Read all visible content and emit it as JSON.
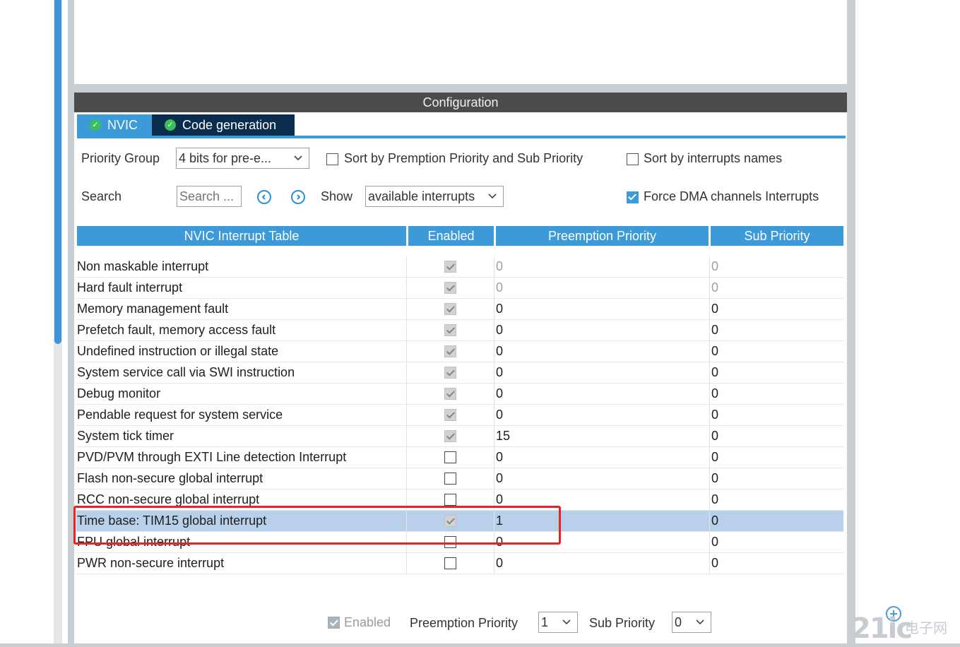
{
  "panel": {
    "title": "Configuration",
    "tabs": [
      {
        "label": "NVIC",
        "active": true
      },
      {
        "label": "Code generation",
        "active": false
      }
    ]
  },
  "toolbar": {
    "priority_group_label": "Priority Group",
    "priority_group_value": "4 bits for pre-e...",
    "sort_premption_label": "Sort by Premption Priority and Sub Priority",
    "sort_premption_checked": false,
    "sort_names_label": "Sort by interrupts names",
    "sort_names_checked": false,
    "search_label": "Search",
    "search_placeholder": "Search ...",
    "show_label": "Show",
    "show_value": "available interrupts",
    "force_dma_label": "Force DMA channels Interrupts",
    "force_dma_checked": true
  },
  "table": {
    "headers": [
      "NVIC Interrupt Table",
      "Enabled",
      "Preemption Priority",
      "Sub Priority"
    ],
    "rows": [
      {
        "name": "Non maskable interrupt",
        "enabled": true,
        "locked": true,
        "preemption": "0",
        "sub": "0",
        "grey_values": true
      },
      {
        "name": "Hard fault interrupt",
        "enabled": true,
        "locked": true,
        "preemption": "0",
        "sub": "0",
        "grey_values": true
      },
      {
        "name": "Memory management fault",
        "enabled": true,
        "locked": true,
        "preemption": "0",
        "sub": "0"
      },
      {
        "name": "Prefetch fault, memory access fault",
        "enabled": true,
        "locked": true,
        "preemption": "0",
        "sub": "0"
      },
      {
        "name": "Undefined instruction or illegal state",
        "enabled": true,
        "locked": true,
        "preemption": "0",
        "sub": "0"
      },
      {
        "name": "System service call via SWI instruction",
        "enabled": true,
        "locked": true,
        "preemption": "0",
        "sub": "0"
      },
      {
        "name": "Debug monitor",
        "enabled": true,
        "locked": true,
        "preemption": "0",
        "sub": "0"
      },
      {
        "name": "Pendable request for system service",
        "enabled": true,
        "locked": true,
        "preemption": "0",
        "sub": "0"
      },
      {
        "name": "System tick timer",
        "enabled": true,
        "locked": true,
        "preemption": "15",
        "sub": "0"
      },
      {
        "name": "PVD/PVM through EXTI Line detection Interrupt",
        "enabled": false,
        "preemption": "0",
        "sub": "0"
      },
      {
        "name": "Flash non-secure global interrupt",
        "enabled": false,
        "preemption": "0",
        "sub": "0"
      },
      {
        "name": "RCC non-secure global interrupt",
        "enabled": false,
        "preemption": "0",
        "sub": "0"
      },
      {
        "name": "Time base: TIM15 global interrupt",
        "enabled": true,
        "locked": true,
        "preemption": "1",
        "sub": "0",
        "selected": true
      },
      {
        "name": "FPU global interrupt",
        "enabled": false,
        "preemption": "0",
        "sub": "0"
      },
      {
        "name": "PWR non-secure interrupt",
        "enabled": false,
        "preemption": "0",
        "sub": "0"
      }
    ]
  },
  "bottom": {
    "enabled_label": "Enabled",
    "enabled_checked": true,
    "preemption_label": "Preemption Priority",
    "preemption_value": "1",
    "sub_label": "Sub Priority",
    "sub_value": "0"
  },
  "watermark": {
    "text": "21ic",
    "subtext": "电子网"
  },
  "colors": {
    "accent": "#3c9ad8",
    "header_dark": "#4b4b4b",
    "tab_dark": "#0b2d4d",
    "selected_row": "#b8d0ea",
    "highlight": "#e82323"
  }
}
